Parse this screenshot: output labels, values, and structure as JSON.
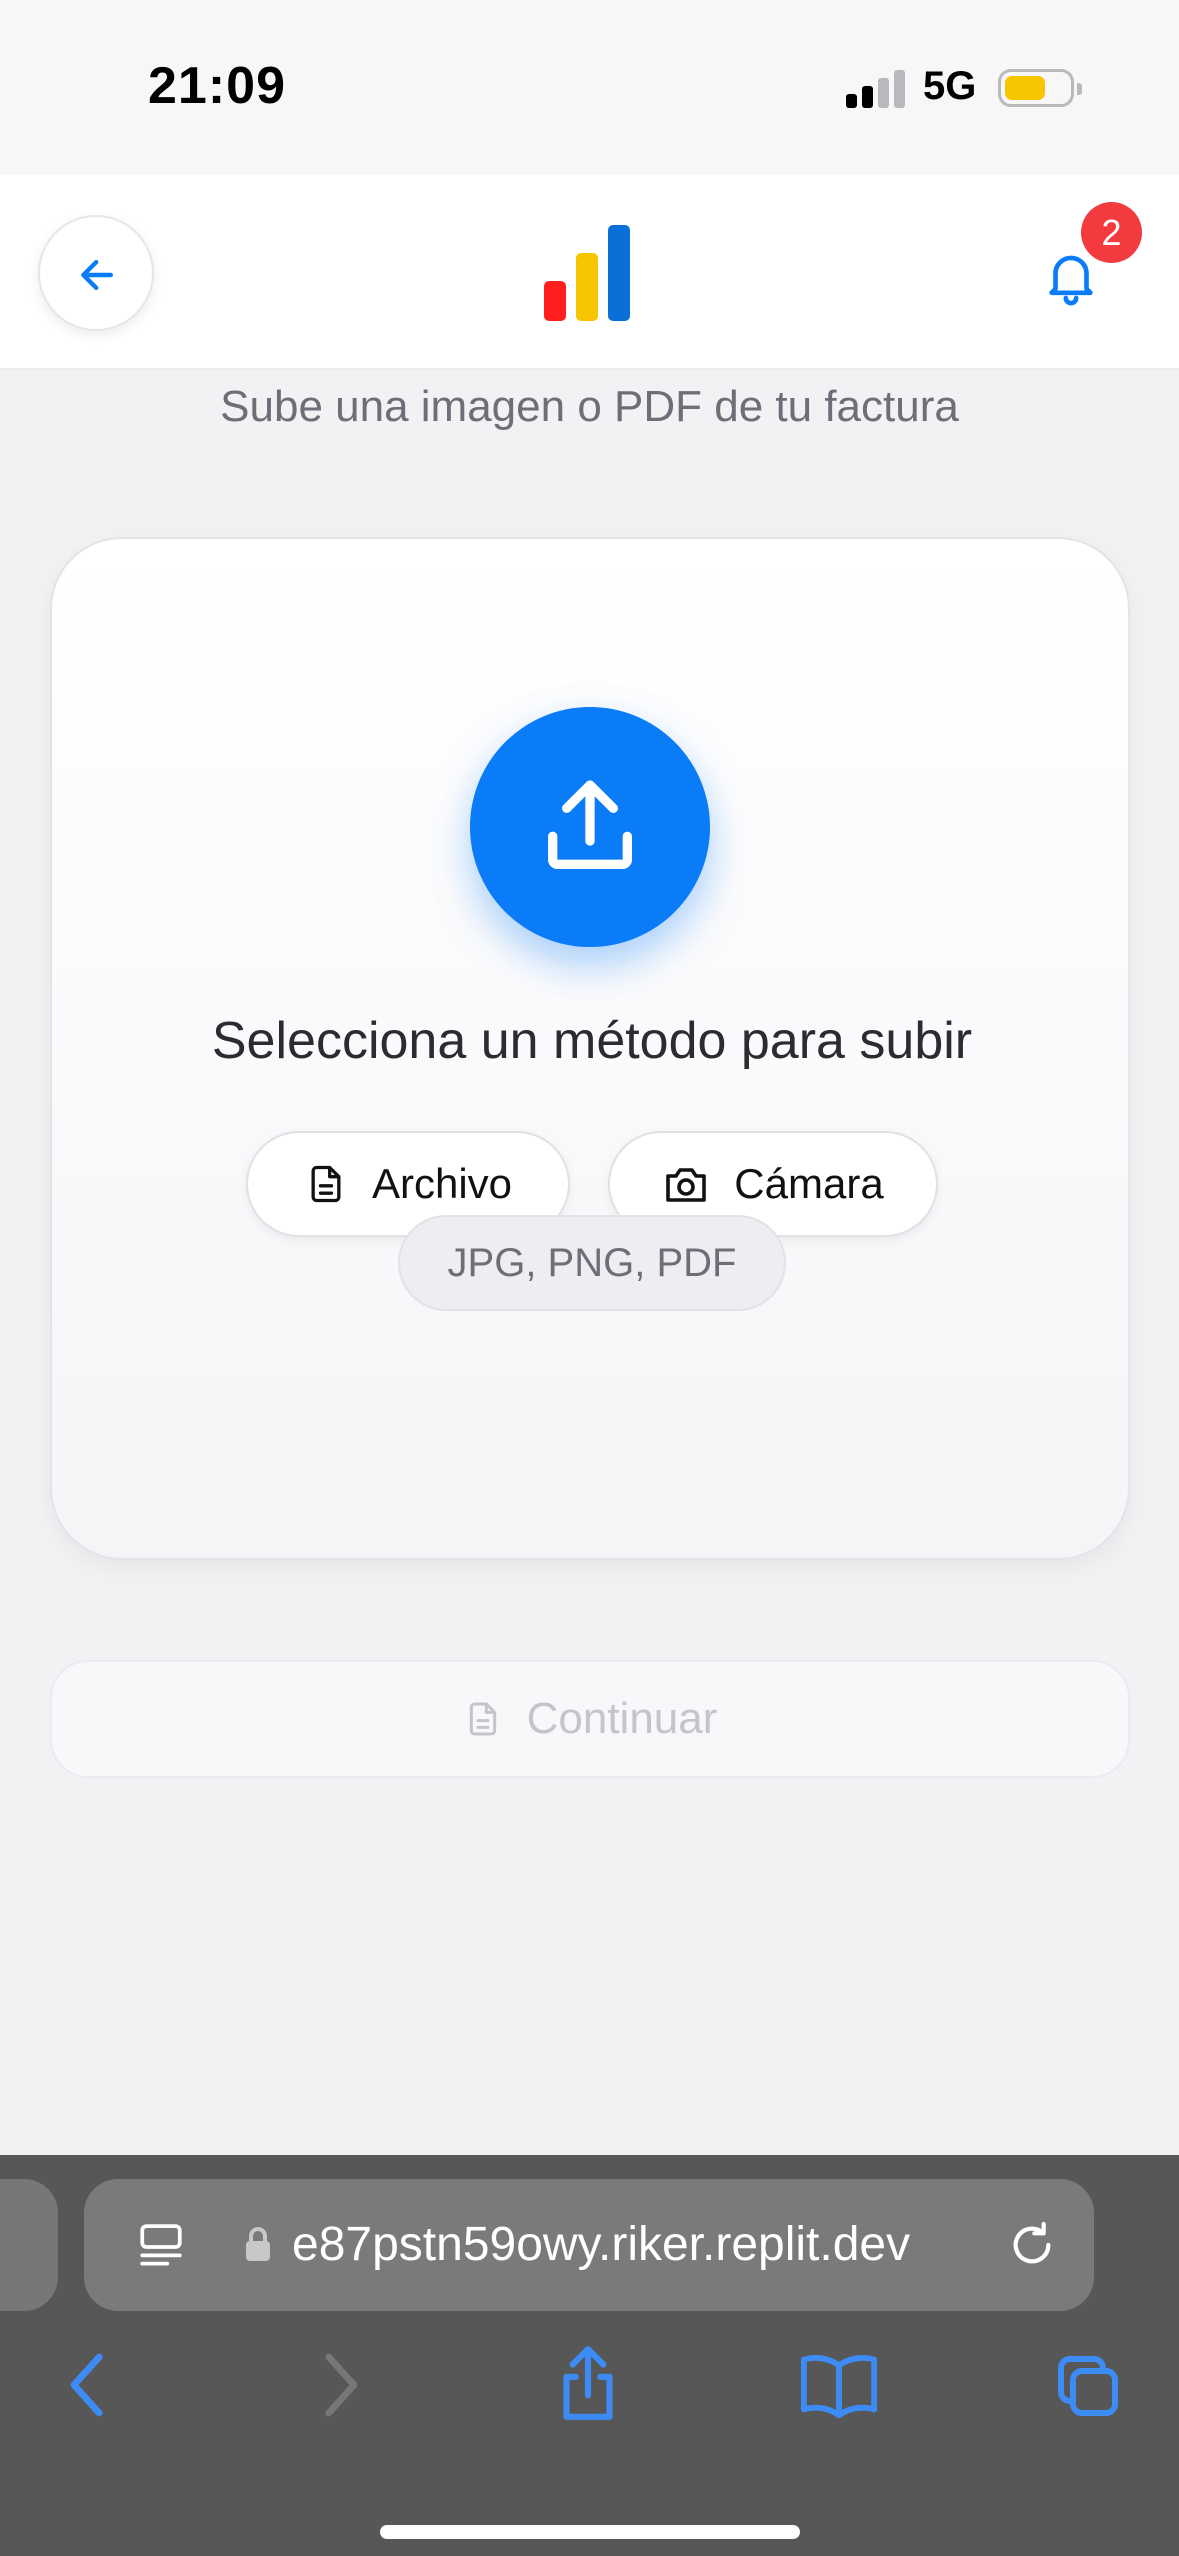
{
  "status_bar": {
    "time": "21:09",
    "network": "5G",
    "battery_level": 0.5,
    "battery_color": "#f7c600"
  },
  "header": {
    "back_icon": "arrow-left-icon",
    "logo_icon": "bar-chart-logo",
    "logo_colors": [
      "#ff1f1f",
      "#f7c600",
      "#0a6fd6"
    ],
    "notification_icon": "bell-icon",
    "notification_count": "2"
  },
  "main": {
    "subtitle": "Sube una imagen o PDF de tu factura",
    "upload_icon": "upload-icon",
    "card_title": "Selecciona un método para subir",
    "file_button_label": "Archivo",
    "camera_button_label": "Cámara",
    "formats_label": "JPG, PNG, PDF",
    "continue_label": "Continuar",
    "accent_color": "#0a7cf7"
  },
  "browser": {
    "url": "e87pstn59owy.riker.replit.dev",
    "icons": [
      "tabs-icon",
      "lock-icon",
      "reload-icon",
      "back-icon",
      "forward-icon",
      "share-icon",
      "bookmarks-icon",
      "tabs-overview-icon"
    ]
  }
}
